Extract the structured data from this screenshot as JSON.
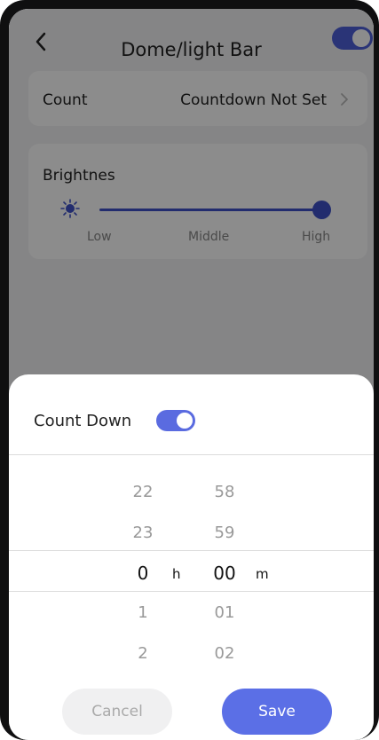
{
  "header": {
    "title": "Dome/light Bar",
    "main_toggle_on": true
  },
  "count_row": {
    "label": "Count",
    "value": "Countdown Not Set"
  },
  "brightness": {
    "label": "Brightnes",
    "level_fraction": 1.0,
    "ticks": [
      "Low",
      "Middle",
      "High"
    ]
  },
  "sheet": {
    "title": "Count Down",
    "toggle_on": true,
    "hours": {
      "above": [
        "22",
        "23"
      ],
      "selected": "0",
      "below": [
        "1",
        "2"
      ],
      "unit": "h"
    },
    "minutes": {
      "above": [
        "58",
        "59"
      ],
      "selected": "00",
      "below": [
        "01",
        "02"
      ],
      "unit": "m"
    },
    "cancel_label": "Cancel",
    "save_label": "Save"
  },
  "colors": {
    "accent": "#5b6fe6",
    "slider": "#3f51c9"
  }
}
